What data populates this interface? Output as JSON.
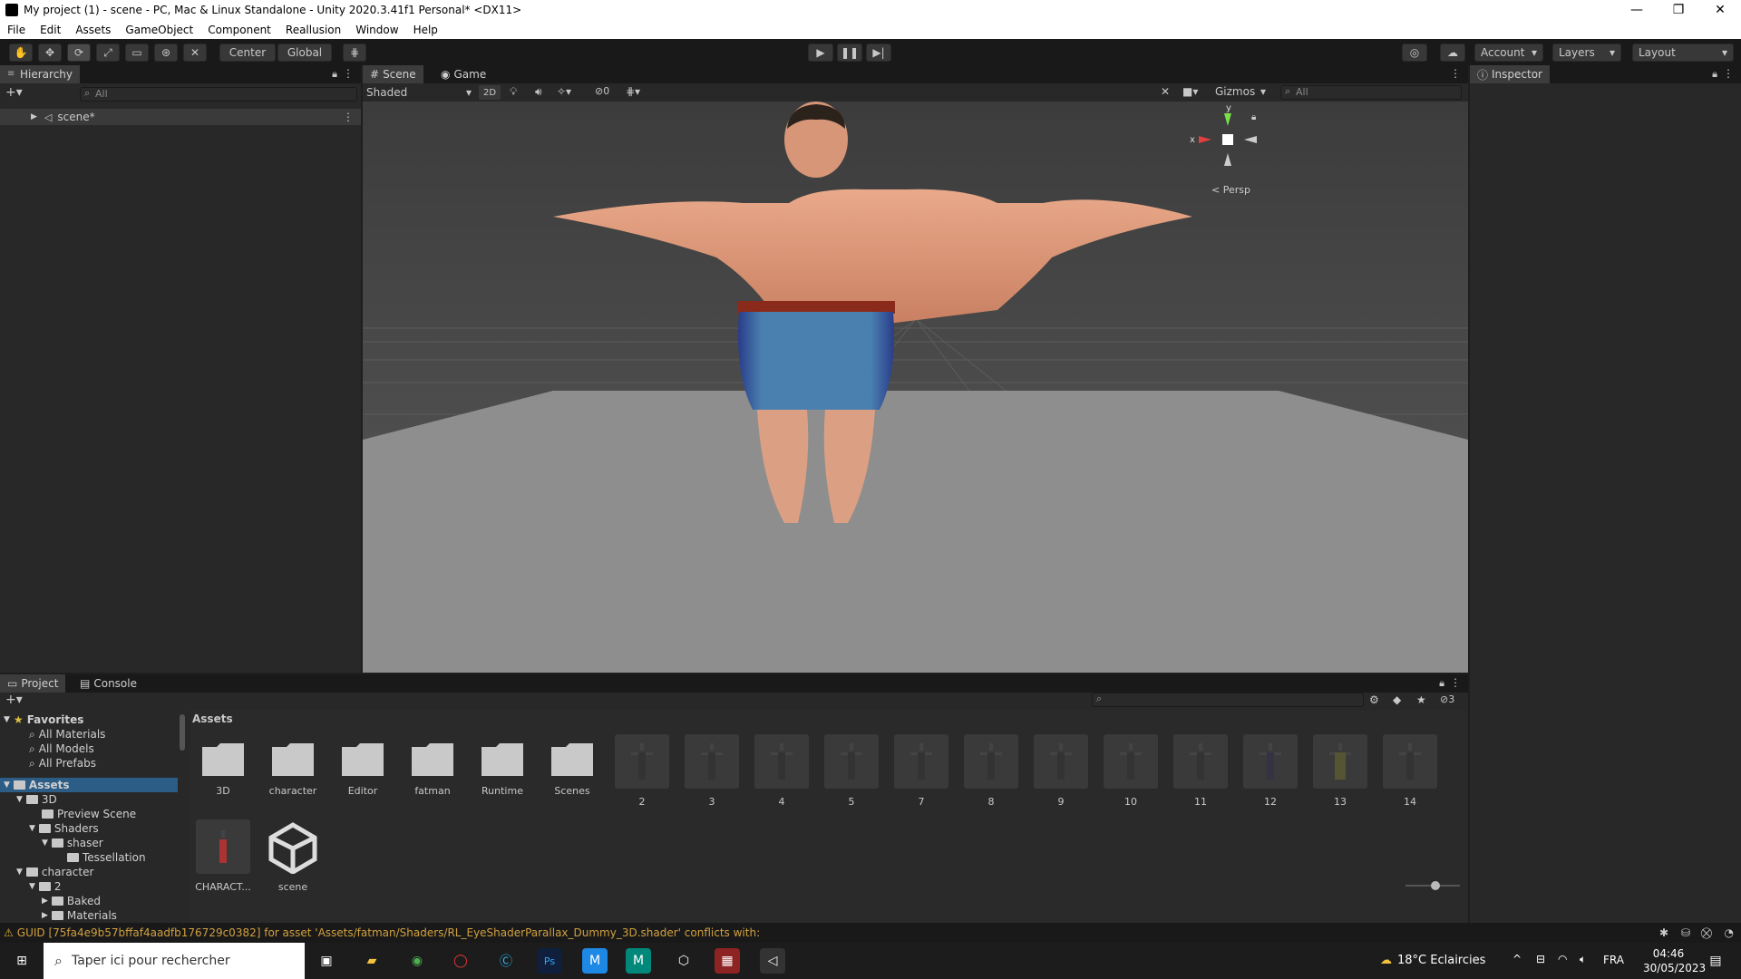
{
  "window": {
    "title": "My project (1) - scene - PC, Mac & Linux Standalone - Unity 2020.3.41f1 Personal* <DX11>",
    "minimize": "—",
    "maximize": "❐",
    "close": "✕"
  },
  "menu": [
    "File",
    "Edit",
    "Assets",
    "GameObject",
    "Component",
    "Reallusion",
    "Window",
    "Help"
  ],
  "toolbar": {
    "pivot": "Center",
    "space": "Global",
    "account": "Account",
    "layers": "Layers",
    "layout": "Layout"
  },
  "hierarchy": {
    "title": "Hierarchy",
    "search_placeholder": "All",
    "root": "scene*"
  },
  "scene": {
    "tab_scene": "Scene",
    "tab_game": "Game",
    "shading": "Shaded",
    "mode2d": "2D",
    "hidden_count": "0",
    "gizmos": "Gizmos",
    "search_placeholder": "All",
    "gizmo_y": "y",
    "gizmo_x": "x",
    "persp": "< Persp"
  },
  "inspector": {
    "title": "Inspector"
  },
  "project": {
    "tab_project": "Project",
    "tab_console": "Console",
    "hidden_count": "3",
    "breadcrumb": "Assets",
    "favorites": {
      "label": "Favorites",
      "items": [
        "All Materials",
        "All Models",
        "All Prefabs"
      ]
    },
    "tree": [
      {
        "label": "Assets",
        "depth": 0
      },
      {
        "label": "3D",
        "depth": 1
      },
      {
        "label": "Preview Scene",
        "depth": 2
      },
      {
        "label": "Shaders",
        "depth": 2
      },
      {
        "label": "shaser",
        "depth": 3
      },
      {
        "label": "Tessellation",
        "depth": 4
      },
      {
        "label": "character",
        "depth": 1
      },
      {
        "label": "2",
        "depth": 2
      },
      {
        "label": "Baked",
        "depth": 3
      },
      {
        "label": "Materials",
        "depth": 3
      }
    ],
    "folders": [
      "3D",
      "character",
      "Editor",
      "fatman",
      "Runtime",
      "Scenes"
    ],
    "models": [
      "2",
      "3",
      "4",
      "5",
      "7",
      "8",
      "9",
      "10",
      "11",
      "12",
      "13",
      "14"
    ],
    "row2": [
      "CHARACT...",
      "scene"
    ]
  },
  "status": {
    "message": "GUID [75fa4e9b57bffaf4aadfb176729c0382] for asset 'Assets/fatman/Shaders/RL_EyeShaderParallax_Dummy_3D.shader' conflicts with:"
  },
  "taskbar": {
    "search_placeholder": "Taper ici pour rechercher",
    "weather": "18°C  Eclaircies",
    "lang": "FRA",
    "time": "04:46",
    "date": "30/05/2023"
  },
  "colors": {
    "accent": "#4d8fd6",
    "warning": "#e0b030"
  }
}
